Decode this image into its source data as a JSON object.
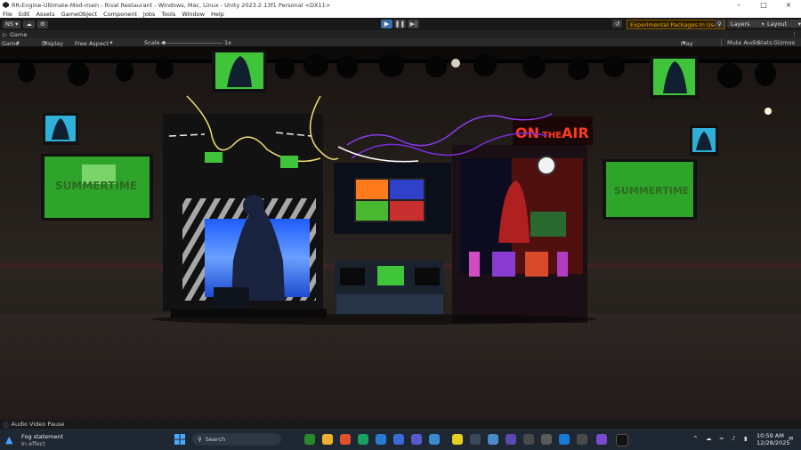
{
  "window": {
    "title": "RR-Engine-Ultimate-Mod-main - Rival Restaurant - Windows, Mac, Linux - Unity 2023.2.13f1 Personal <DX11>"
  },
  "menu": [
    "File",
    "Edit",
    "Assets",
    "GameObject",
    "Component",
    "Jobs",
    "Tools",
    "Window",
    "Help"
  ],
  "toolbar": {
    "account_label": "NS",
    "experimental_label": "Experimental Packages In Use",
    "layers_label": "Layers",
    "layout_label": "Layout"
  },
  "tab": {
    "label": "Game"
  },
  "gamebar": {
    "mode": "Game",
    "display": "Display 1",
    "aspect": "Free Aspect",
    "scale_label": "Scale",
    "scale_value": "1x",
    "play_focused": "Play Focused",
    "mute_audio": "Mute Audio",
    "stats": "Stats",
    "gizmos": "Gizmos"
  },
  "scene": {
    "on_air_text_1": "ON",
    "on_air_text_2": "THE",
    "on_air_text_3": "AIR"
  },
  "status": {
    "message": "Audio Video Pause"
  },
  "taskbar": {
    "notification_title": "Fog statement",
    "notification_sub": "In effect",
    "search_placeholder": "Search",
    "time": "10:59 AM",
    "date": "12/28/2025"
  },
  "colors": {
    "accent": "#4a9eff",
    "experimental": "#f4a300",
    "on_air": "#ff3a20"
  }
}
